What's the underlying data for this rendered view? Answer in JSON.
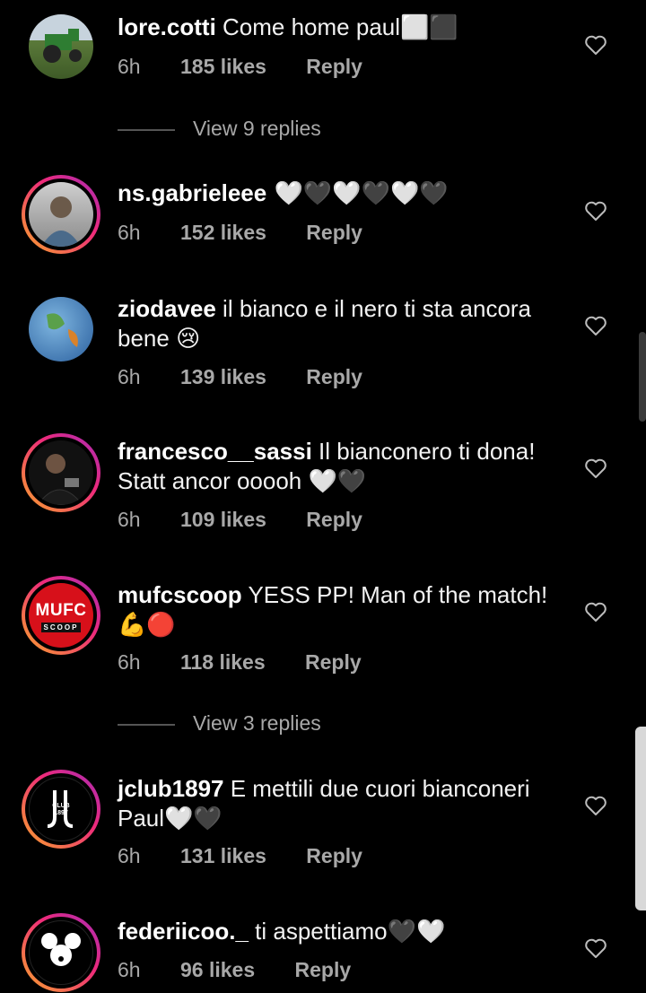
{
  "comments": [
    {
      "username": "lore.cotti",
      "text": " Come home paul⬜⬛",
      "time": "6h",
      "likes": "185 likes",
      "reply": "Reply"
    },
    {
      "username": "ns.gabrieleee",
      "text": " 🤍🖤🤍🖤🤍🖤",
      "time": "6h",
      "likes": "152 likes",
      "reply": "Reply"
    },
    {
      "username": "ziodavee",
      "text": " il bianco e il nero ti sta ancora bene 😢",
      "time": "6h",
      "likes": "139 likes",
      "reply": "Reply"
    },
    {
      "username": "francesco__sassi",
      "text": " Il bianconero ti dona! Statt ancor ooooh 🤍🖤",
      "time": "6h",
      "likes": "109 likes",
      "reply": "Reply"
    },
    {
      "username": "mufcscoop",
      "text": " YESS PP!  Man of the match! 💪🔴",
      "time": "6h",
      "likes": "118 likes",
      "reply": "Reply"
    },
    {
      "username": "jclub1897",
      "text": " E mettili due cuori bianconeri Paul🤍🖤",
      "time": "6h",
      "likes": "131 likes",
      "reply": "Reply"
    },
    {
      "username": "federiicoo._",
      "text": " ti aspettiamo🖤🤍",
      "time": "6h",
      "likes": "96 likes",
      "reply": "Reply"
    }
  ],
  "view_replies": [
    "View 9 replies",
    "View 3 replies"
  ],
  "mufc_logo": {
    "line1": "MUFC",
    "line2": "SCOOP"
  },
  "jclub_logo": {
    "line1": "CLUB",
    "line2": "1897"
  },
  "colors": {
    "background": "#000000",
    "secondary_text": "#a8a8a8",
    "story_ring": "#ee2a7b"
  },
  "icons": {
    "like": "heart-outline-icon"
  }
}
